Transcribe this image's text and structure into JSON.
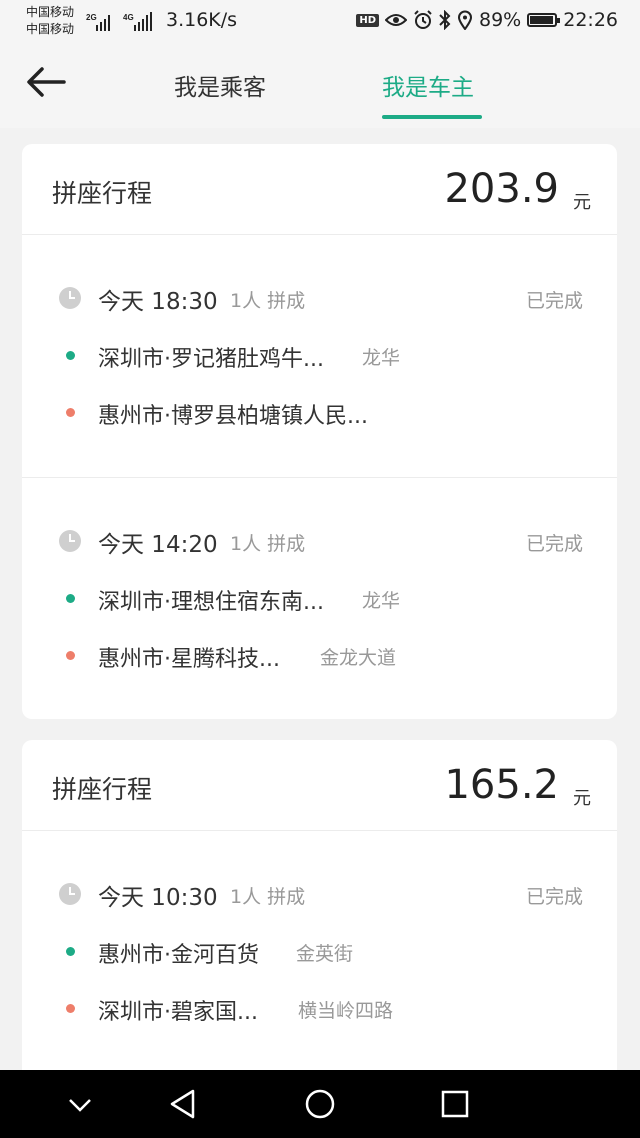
{
  "status_bar": {
    "carrier_line1": "中国移动",
    "carrier_line2": "中国移动",
    "net_sim1": "2G",
    "net_sim2": "4G",
    "speed": "3.16K/s",
    "hd_label": "HD",
    "battery_text": "89%",
    "battery_level": 0.89,
    "time": "22:26",
    "icons": [
      "signal-icon",
      "eye-icon",
      "alarm-icon",
      "bluetooth-icon",
      "location-icon",
      "battery-icon"
    ]
  },
  "header": {
    "back_icon": "arrow-left-icon",
    "tabs": [
      {
        "label": "我是乘客",
        "active": false
      },
      {
        "label": "我是车主",
        "active": true
      }
    ]
  },
  "colors": {
    "accent": "#1dab86",
    "origin_dot": "#1dab86",
    "destination_dot": "#ee7e6a",
    "muted_text": "#999999"
  },
  "cards": [
    {
      "title": "拼座行程",
      "amount": "203.9",
      "unit": "元",
      "trips": [
        {
          "time": "今天 18:30",
          "passengers": "1人 拼成",
          "status": "已完成",
          "origin": "深圳市·罗记猪肚鸡牛...",
          "origin_district": "龙华",
          "destination": "惠州市·博罗县柏塘镇人民...",
          "destination_district": ""
        },
        {
          "time": "今天 14:20",
          "passengers": "1人 拼成",
          "status": "已完成",
          "origin": "深圳市·理想住宿东南...",
          "origin_district": "龙华",
          "destination": "惠州市·星腾科技...",
          "destination_district": "金龙大道"
        }
      ]
    },
    {
      "title": "拼座行程",
      "amount": "165.2",
      "unit": "元",
      "trips": [
        {
          "time": "今天 10:30",
          "passengers": "1人 拼成",
          "status": "已完成",
          "origin": "惠州市·金河百货",
          "origin_district": "金英街",
          "destination": "深圳市·碧家国...",
          "destination_district": "横当岭四路"
        }
      ]
    }
  ],
  "system_nav": {
    "buttons": [
      "chevron-down-icon",
      "back-triangle-icon",
      "home-circle-icon",
      "recents-square-icon"
    ]
  }
}
